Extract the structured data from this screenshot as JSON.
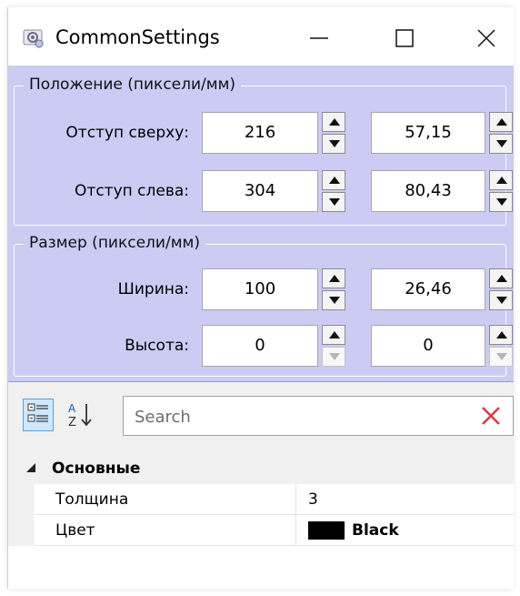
{
  "window": {
    "title": "CommonSettings",
    "icon": "gear-app-icon"
  },
  "position_group": {
    "legend": "Положение (пиксели/мм)",
    "rows": [
      {
        "label": "Отступ сверху:",
        "pixels": "216",
        "mm": "57,15"
      },
      {
        "label": "Отступ слева:",
        "pixels": "304",
        "mm": "80,43"
      }
    ]
  },
  "size_group": {
    "legend": "Размер (пиксели/мм)",
    "rows": [
      {
        "label": "Ширина:",
        "pixels": "100",
        "mm": "26,46"
      },
      {
        "label": "Высота:",
        "pixels": "0",
        "mm": "0"
      }
    ]
  },
  "toolbar": {
    "search_placeholder": "Search"
  },
  "property_grid": {
    "category": "Основные",
    "properties": [
      {
        "name": "Толщина",
        "value": "3"
      },
      {
        "name": "Цвет",
        "value": "Black",
        "swatch": "#000000"
      }
    ]
  },
  "colors": {
    "panel_bg": "#cbcbf4",
    "toolbar_bg": "#f0f0f0",
    "clear_icon": "#e0343a",
    "selected_button": "#cfe8ff"
  }
}
